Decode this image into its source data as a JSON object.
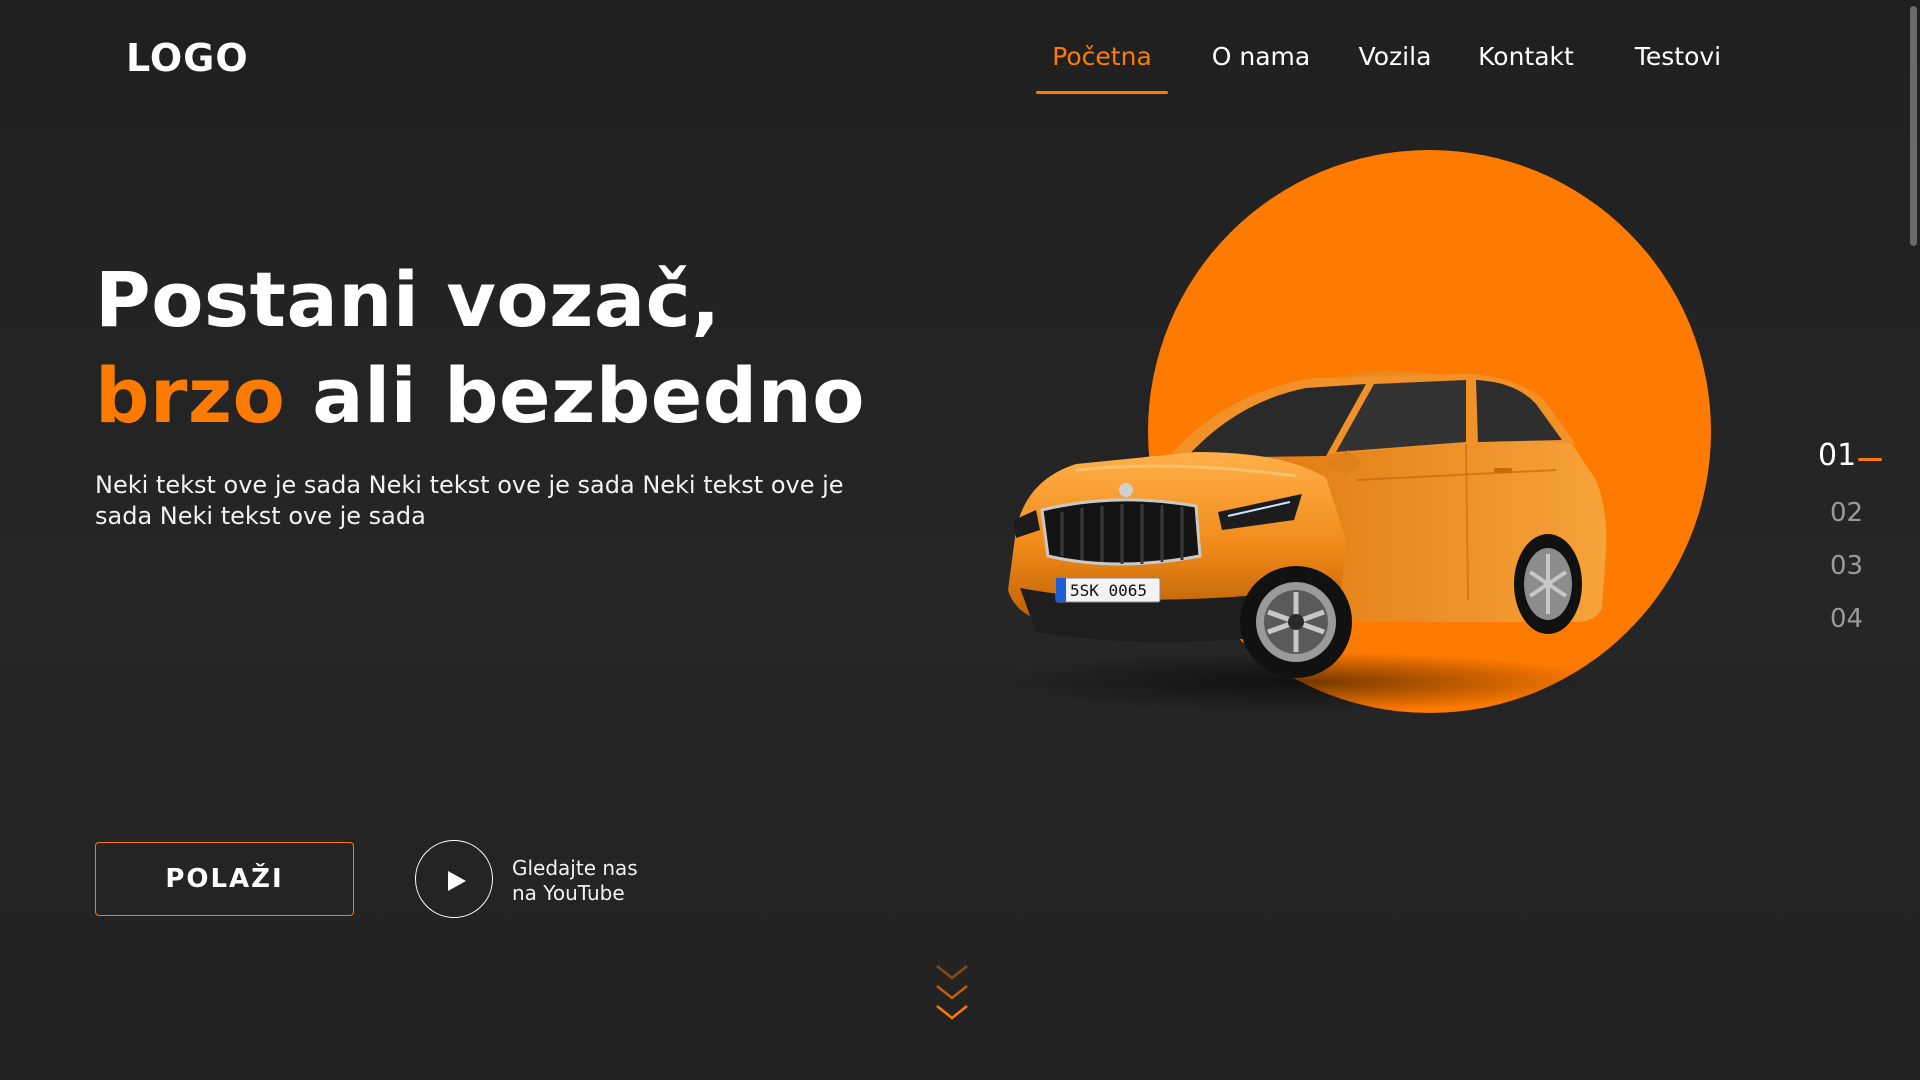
{
  "header": {
    "logo": "LOGO",
    "nav": [
      {
        "label": "Početna",
        "active": true
      },
      {
        "label": "O nama",
        "active": false
      },
      {
        "label": "Vozila",
        "active": false
      },
      {
        "label": "Kontakt",
        "active": false
      },
      {
        "label": "Testovi",
        "active": false
      }
    ]
  },
  "hero": {
    "title_line1": "Postani vozač,",
    "title_accent": "brzo",
    "title_rest": " ali bezbedno",
    "description": "Neki tekst ove je sada Neki tekst ove je sada Neki tekst ove je sada Neki tekst ove je sada",
    "cta_label": "POLAŽI",
    "youtube_line1": "Gledajte nas",
    "youtube_line2": "na YouTube"
  },
  "car": {
    "plate": "5SK 0065",
    "icon": "car-image"
  },
  "slides": {
    "items": [
      "01",
      "02",
      "03",
      "04"
    ],
    "active_index": 0
  },
  "colors": {
    "accent": "#ff7a00",
    "background": "#232323",
    "text": "#ffffff",
    "muted": "#9a9a9a"
  },
  "icons": {
    "play": "play-icon",
    "scroll": "chevrons-down-icon"
  }
}
